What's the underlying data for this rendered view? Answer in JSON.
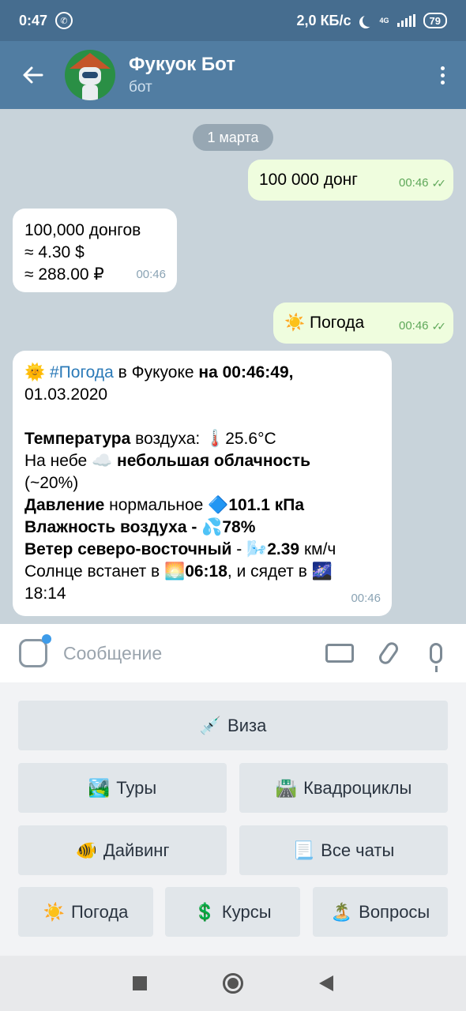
{
  "status": {
    "time": "0:47",
    "speed": "2,0 КБ/с",
    "network": "4G",
    "battery": "79"
  },
  "header": {
    "title": "Фукуок Бот",
    "subtitle": "бот"
  },
  "chat": {
    "date": "1 марта",
    "m1": {
      "text": "100 000 донг",
      "time": "00:46"
    },
    "m2": {
      "line1": "100,000 донгов",
      "line2": "≈ 4.30 $",
      "line3": "≈ 288.00 ₽",
      "time": "00:46"
    },
    "m3": {
      "icon": "☀️",
      "text": "Погода",
      "time": "00:46"
    },
    "m4": {
      "emoji_sun": "🌞",
      "hashtag": "#Погода",
      "in_text": " в Фукуоке ",
      "at_text": "на 00:46:49,",
      "date": "01.03.2020",
      "temp_label": "Температура",
      "temp_rest": " воздуха: ",
      "temp_emoji": "🌡️",
      "temp_value": "25.6°C",
      "sky_label": "На небе ",
      "sky_emoji": "☁️",
      "sky_value": " небольшая облачность",
      "sky_pct": "(~20%)",
      "press_label": "Давление",
      "press_rest": " нормальное ",
      "press_emoji": "🔷",
      "press_value": "101.1 кПа",
      "hum_label": "Влажность воздуха - ",
      "hum_emoji": "💦",
      "hum_value": "78%",
      "wind_label": "Ветер северо-восточный ",
      "wind_dash": " - ",
      "wind_emoji": "🌬️",
      "wind_value": "2.39",
      "wind_unit": " км/ч",
      "sun_text": "Солнце встанет в ",
      "sunrise_emoji": "🌅",
      "sunrise": "06:18",
      "sun_text2": ", и сядет в ",
      "sunset_emoji": "🌌",
      "sunset": "18:14",
      "time": "00:46"
    }
  },
  "input": {
    "placeholder": "Сообщение"
  },
  "keyboard": {
    "visa": {
      "icon": "💉",
      "label": "Виза"
    },
    "tours": {
      "icon": "🏞️",
      "label": "Туры"
    },
    "quads": {
      "icon": "🛣️",
      "label": "Квадроциклы"
    },
    "diving": {
      "icon": "🐠",
      "label": "Дайвинг"
    },
    "chats": {
      "icon": "📃",
      "label": "Все чаты"
    },
    "weather": {
      "icon": "☀️",
      "label": "Погода"
    },
    "rates": {
      "icon": "💲",
      "label": "Курсы"
    },
    "faq": {
      "icon": "🏝️",
      "label": "Вопросы"
    }
  }
}
